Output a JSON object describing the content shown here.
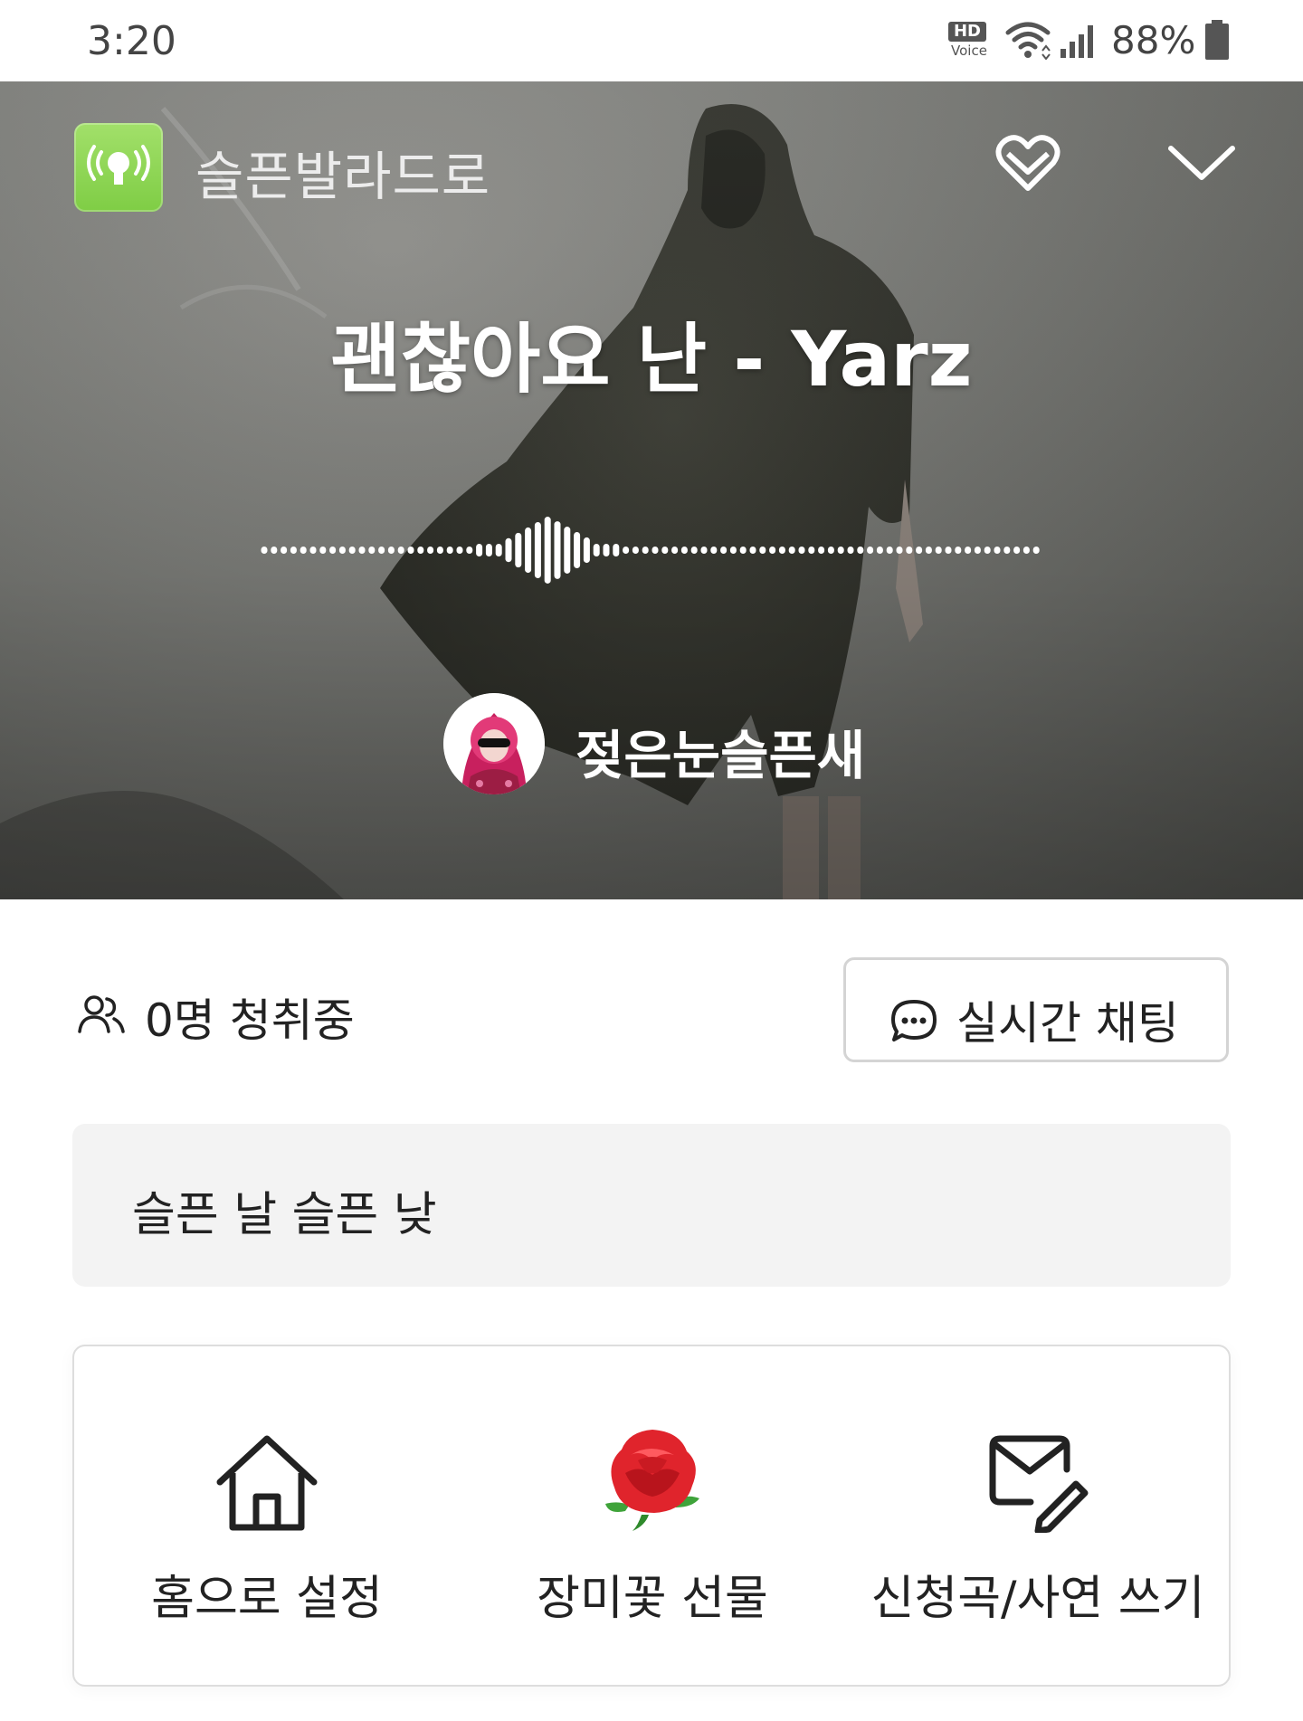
{
  "status_bar": {
    "time": "3:20",
    "hd_badge": "HD",
    "hd_voice": "Voice",
    "battery": "88%",
    "icons": [
      "hd-voice-icon",
      "wifi-icon",
      "signal-icon",
      "battery-icon"
    ]
  },
  "channel": {
    "name": "슬픈발라드로",
    "icon": "radio-broadcast-icon",
    "accent": "#8cd350"
  },
  "now_playing": {
    "title": "괜찮아요 난 - Yarz"
  },
  "dj": {
    "name": "젖은눈슬픈새",
    "avatar": "avatar"
  },
  "listeners": {
    "text": "0명 청취중",
    "icon": "people-icon"
  },
  "chat": {
    "label": "실시간 채팅",
    "icon": "chat-bubble-icon"
  },
  "description": "슬픈 날 슬픈 낮",
  "actions": [
    {
      "label": "홈으로 설정",
      "icon": "home-icon"
    },
    {
      "label": "장미꽃 선물",
      "icon": "rose-icon"
    },
    {
      "label": "신청곡/사연 쓰기",
      "icon": "mail-edit-icon"
    }
  ]
}
